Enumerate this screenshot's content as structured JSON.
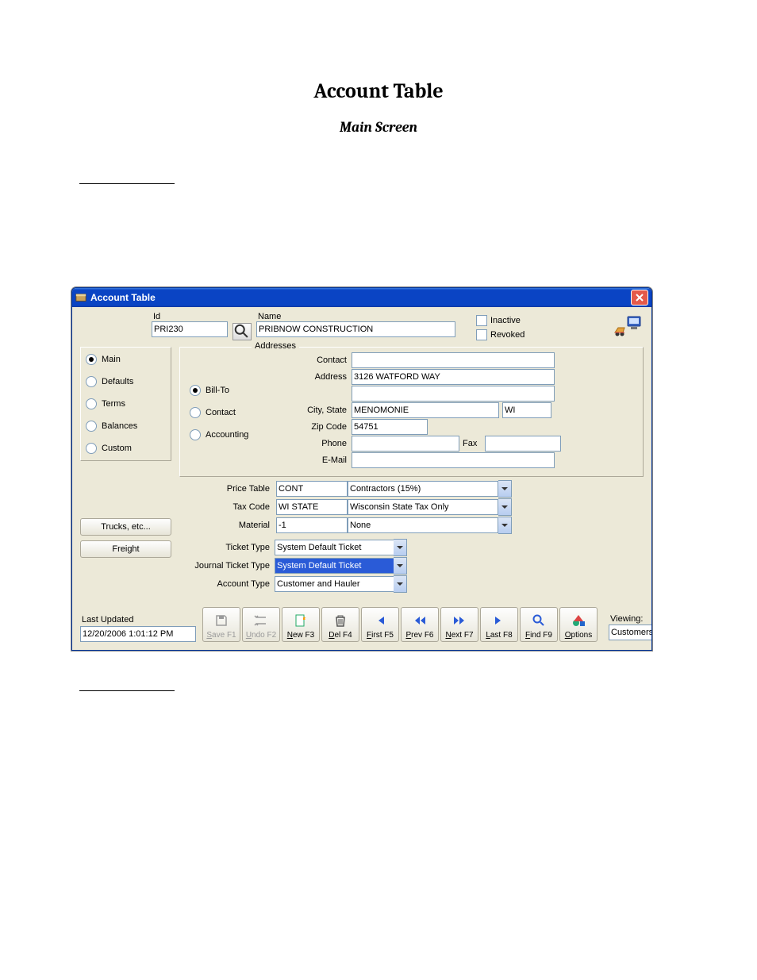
{
  "doc": {
    "title": "Account Table",
    "subtitle": "Main Screen"
  },
  "window": {
    "title": "Account Table",
    "closeTooltip": "Close"
  },
  "header": {
    "idLabel": "Id",
    "idValue": "PRI230",
    "nameLabel": "Name",
    "nameValue": "PRIBNOW CONSTRUCTION",
    "inactiveLabel": "Inactive",
    "revokedLabel": "Revoked"
  },
  "leftNav": {
    "options": [
      {
        "label": "Main",
        "checked": true
      },
      {
        "label": "Defaults",
        "checked": false
      },
      {
        "label": "Terms",
        "checked": false
      },
      {
        "label": "Balances",
        "checked": false
      },
      {
        "label": "Custom",
        "checked": false
      }
    ],
    "trucksBtn": "Trucks, etc...",
    "freightBtn": "Freight"
  },
  "addresses": {
    "legend": "Addresses",
    "radios": [
      {
        "label": "Bill-To",
        "checked": true
      },
      {
        "label": "Contact",
        "checked": false
      },
      {
        "label": "Accounting",
        "checked": false
      }
    ],
    "contactLabel": "Contact",
    "contactValue": "",
    "addressLabel": "Address",
    "address1": "3126 WATFORD WAY",
    "address2": "",
    "cityStateLabel": "City, State",
    "city": "MENOMONIE",
    "state": "WI",
    "zipLabel": "Zip Code",
    "zip": "54751",
    "phoneLabel": "Phone",
    "phone": "",
    "faxLabel": "Fax",
    "fax": "",
    "emailLabel": "E-Mail",
    "email": ""
  },
  "lower": {
    "priceTableLabel": "Price Table",
    "priceTableCode": "CONT",
    "priceTableDesc": "Contractors (15%)",
    "taxCodeLabel": "Tax Code",
    "taxCodeCode": "WI STATE",
    "taxCodeDesc": "Wisconsin State Tax Only",
    "materialLabel": "Material",
    "materialCode": "-1",
    "materialDesc": "None",
    "ticketTypeLabel": "Ticket Type",
    "ticketTypeValue": "System Default Ticket",
    "journalTicketLabel": "Journal Ticket Type",
    "journalTicketValue": "System Default Ticket",
    "accountTypeLabel": "Account Type",
    "accountTypeValue": "Customer and Hauler"
  },
  "footer": {
    "lastUpdatedLabel": "Last Updated",
    "lastUpdatedValue": "12/20/2006 1:01:12 PM",
    "toolbar": [
      {
        "label": "Save F1",
        "icon": "save-icon",
        "disabled": true
      },
      {
        "label": "Undo F2",
        "icon": "undo-icon",
        "disabled": true
      },
      {
        "label": "New F3",
        "icon": "new-icon",
        "disabled": false
      },
      {
        "label": "Del F4",
        "icon": "trash-icon",
        "disabled": false
      },
      {
        "label": "First F5",
        "icon": "first-icon",
        "disabled": false
      },
      {
        "label": "Prev F6",
        "icon": "prev-icon",
        "disabled": false
      },
      {
        "label": "Next F7",
        "icon": "next-icon",
        "disabled": false
      },
      {
        "label": "Last F8",
        "icon": "last-icon",
        "disabled": false
      },
      {
        "label": "Find F9",
        "icon": "find-icon",
        "disabled": false
      },
      {
        "label": "Options",
        "icon": "options-icon",
        "disabled": false
      }
    ],
    "viewingLabel": "Viewing:",
    "viewingValue": "Customers and Haulers"
  }
}
